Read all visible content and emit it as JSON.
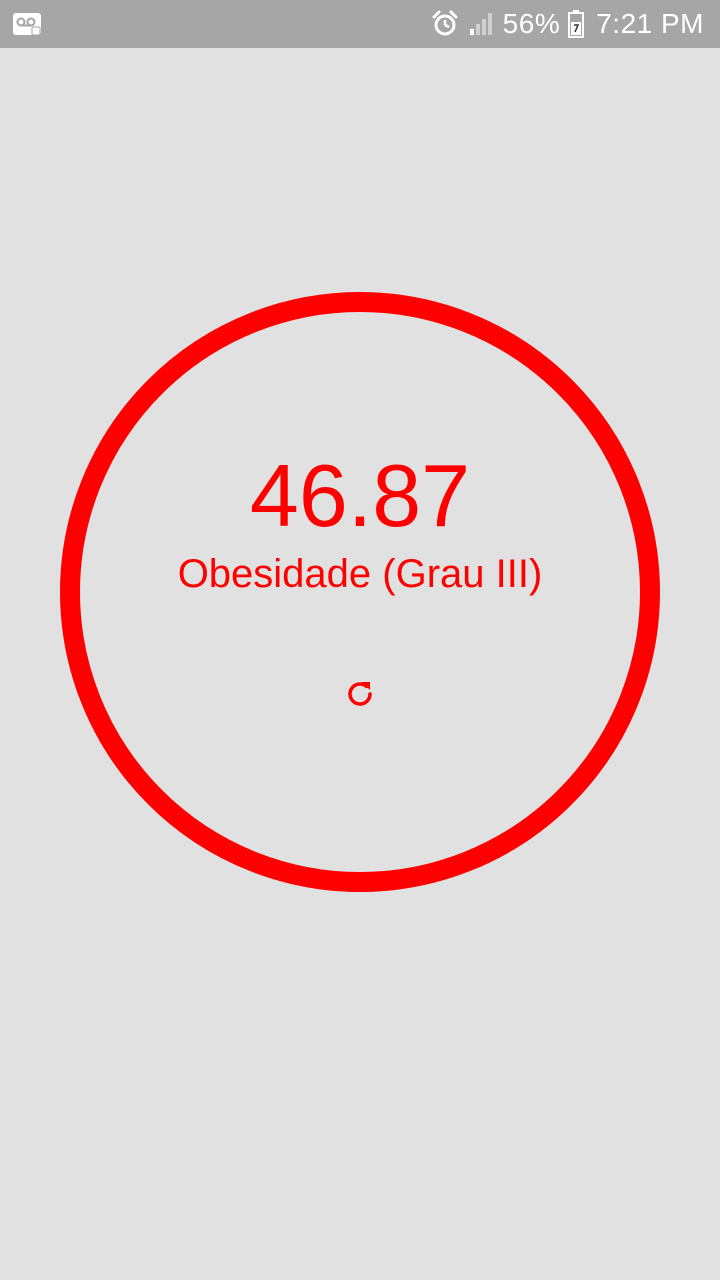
{
  "status_bar": {
    "battery_percent": "56%",
    "time": "7:21 PM",
    "icons": [
      "voicemail-icon",
      "alarm-icon",
      "signal-icon",
      "battery-icon"
    ]
  },
  "result": {
    "value": "46.87",
    "label": "Obesidade (Grau III)",
    "accent_color": "#ff0000"
  },
  "actions": {
    "reset_icon": "refresh-icon"
  },
  "colors": {
    "background": "#e1e1e1",
    "status_bar": "#a6a6a6",
    "accent": "#ff0000"
  }
}
